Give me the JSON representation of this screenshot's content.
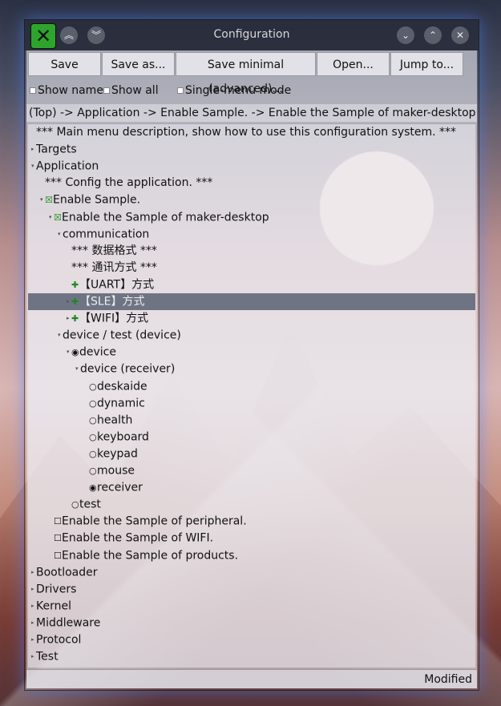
{
  "window": {
    "title": "Configuration"
  },
  "toolbar": {
    "save": "Save",
    "save_as": "Save as...",
    "save_minimal": "Save minimal (advanced)...",
    "open": "Open...",
    "jump_to": "Jump to..."
  },
  "options": {
    "show_name": "Show name",
    "show_all": "Show all",
    "single_menu": "Single-menu mode"
  },
  "breadcrumb": "(Top) -> Application -> Enable Sample. -> Enable the Sample of maker-desktop -> communication",
  "tree": [
    {
      "label": "*** Main menu description, show how to use this configuration system. ***",
      "indent": 0,
      "arrow": "",
      "mark": ""
    },
    {
      "label": "Targets",
      "indent": 0,
      "arrow": "▸",
      "mark": ""
    },
    {
      "label": "Application",
      "indent": 0,
      "arrow": "▾",
      "mark": ""
    },
    {
      "label": "*** Config the application. ***",
      "indent": 1,
      "arrow": "",
      "mark": ""
    },
    {
      "label": "Enable Sample.",
      "indent": 1,
      "arrow": "▾",
      "mark": "☒"
    },
    {
      "label": "Enable the Sample of maker-desktop",
      "indent": 2,
      "arrow": "▾",
      "mark": "☒"
    },
    {
      "label": "communication",
      "indent": 3,
      "arrow": "▾",
      "mark": ""
    },
    {
      "label": "*** 数据格式 ***",
      "indent": 4,
      "arrow": "",
      "mark": ""
    },
    {
      "label": "*** 通讯方式 ***",
      "indent": 4,
      "arrow": "",
      "mark": ""
    },
    {
      "label": "【UART】方式",
      "indent": 4,
      "arrow": "",
      "mark": "✚"
    },
    {
      "label": "【SLE】方式",
      "indent": 4,
      "arrow": "▸",
      "mark": "✚"
    },
    {
      "label": "【WIFI】方式",
      "indent": 4,
      "arrow": "▸",
      "mark": "✚"
    },
    {
      "label": "device / test (device)",
      "indent": 3,
      "arrow": "▾",
      "mark": ""
    },
    {
      "label": "device",
      "indent": 4,
      "arrow": "▾",
      "mark": "◉"
    },
    {
      "label": "device (receiver)",
      "indent": 5,
      "arrow": "▾",
      "mark": ""
    },
    {
      "label": "deskaide",
      "indent": 6,
      "arrow": "",
      "mark": "○"
    },
    {
      "label": "dynamic",
      "indent": 6,
      "arrow": "",
      "mark": "○"
    },
    {
      "label": "health",
      "indent": 6,
      "arrow": "",
      "mark": "○"
    },
    {
      "label": "keyboard",
      "indent": 6,
      "arrow": "",
      "mark": "○"
    },
    {
      "label": "keypad",
      "indent": 6,
      "arrow": "",
      "mark": "○"
    },
    {
      "label": "mouse",
      "indent": 6,
      "arrow": "",
      "mark": "○"
    },
    {
      "label": "receiver",
      "indent": 6,
      "arrow": "",
      "mark": "◉"
    },
    {
      "label": "test",
      "indent": 4,
      "arrow": "",
      "mark": "○"
    },
    {
      "label": "Enable the Sample of peripheral.",
      "indent": 2,
      "arrow": "",
      "mark": "☐"
    },
    {
      "label": "Enable the Sample of WIFI.",
      "indent": 2,
      "arrow": "",
      "mark": "☐"
    },
    {
      "label": "Enable the Sample of products.",
      "indent": 2,
      "arrow": "",
      "mark": "☐"
    },
    {
      "label": "Bootloader",
      "indent": 0,
      "arrow": "▸",
      "mark": ""
    },
    {
      "label": "Drivers",
      "indent": 0,
      "arrow": "▸",
      "mark": ""
    },
    {
      "label": "Kernel",
      "indent": 0,
      "arrow": "▸",
      "mark": ""
    },
    {
      "label": "Middleware",
      "indent": 0,
      "arrow": "▸",
      "mark": ""
    },
    {
      "label": "Protocol",
      "indent": 0,
      "arrow": "▸",
      "mark": ""
    },
    {
      "label": "Test",
      "indent": 0,
      "arrow": "▸",
      "mark": ""
    }
  ],
  "selected_label": "【SLE】方式",
  "status": "Modified"
}
